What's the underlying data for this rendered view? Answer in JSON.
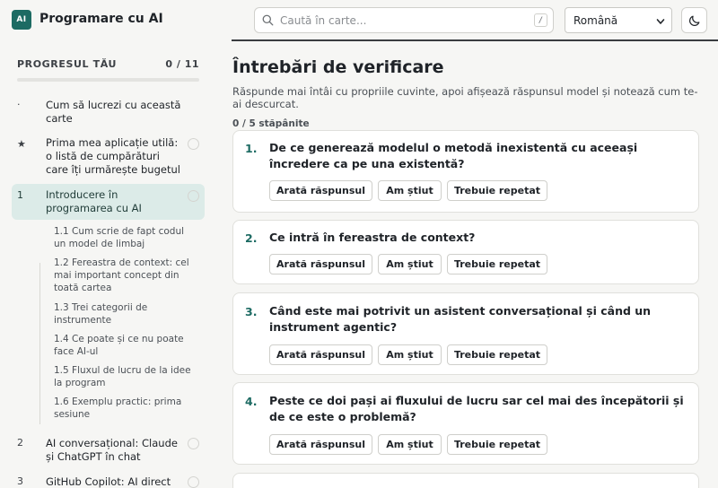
{
  "header": {
    "logo_text": "AI",
    "title": "Programare cu AI",
    "search_placeholder": "Caută în carte...",
    "search_shortcut": "/",
    "language": "Română",
    "theme_icon": "moon-icon"
  },
  "sidebar": {
    "progress_label": "PROGRESUL TĂU",
    "progress_count": "0 / 11",
    "progress_fraction": 0,
    "chapters": [
      {
        "num": "·",
        "label": "Cum să lucrezi cu această carte"
      },
      {
        "num": "★",
        "label": "Prima mea aplicație utilă: o listă de cumpărături care îți urmărește bugetul"
      },
      {
        "num": "1",
        "label": "Introducere în programarea cu AI"
      },
      {
        "num": "2",
        "label": "AI conversațional: Claude și ChatGPT în chat"
      },
      {
        "num": "3",
        "label": "GitHub Copilot: AI direct în"
      }
    ],
    "subsections": [
      "1.1  Cum scrie de fapt codul un model de limbaj",
      "1.2  Fereastra de context: cel mai important concept din toată cartea",
      "1.3  Trei categorii de instrumente",
      "1.4  Ce poate și ce nu poate face AI-ul",
      "1.5  Fluxul de lucru de la idee la program",
      "1.6  Exemplu practic: prima sesiune"
    ]
  },
  "main": {
    "title": "Întrebări de verificare",
    "intro": "Răspunde mai întâi cu propriile cuvinte, apoi afișează răspunsul model și notează cum te-ai descurcat.",
    "mastered": "0 / 5 stăpânite",
    "buttons": {
      "show": "Arată răspunsul",
      "known": "Am știut",
      "repeat": "Trebuie repetat"
    },
    "questions": [
      {
        "num": "1.",
        "text": "De ce generează modelul o metodă inexistentă cu aceeași încredere ca pe una existentă?"
      },
      {
        "num": "2.",
        "text": "Ce intră în fereastra de context?"
      },
      {
        "num": "3.",
        "text": "Când este mai potrivit un asistent conversațional și când un instrument agentic?"
      },
      {
        "num": "4.",
        "text": "Peste ce doi pași ai fluxului de lucru sar cel mai des începătorii și de ce este o problemă?"
      }
    ]
  }
}
